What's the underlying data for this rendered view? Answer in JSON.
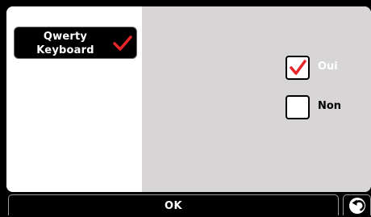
{
  "sidebar": {
    "items": [
      {
        "label": "Qwerty\nKeyboard",
        "icon": "checkmark-icon",
        "selected": true
      }
    ]
  },
  "options": [
    {
      "label": "Oui",
      "checked": true,
      "icon": "checkmark-icon"
    },
    {
      "label": "Non",
      "checked": false
    }
  ],
  "footer": {
    "ok_label": "OK",
    "back_icon": "back-arrow-icon"
  },
  "colors": {
    "check": "#e8262a",
    "content_bg": "#d7d5d6",
    "bar_bg": "#000000"
  }
}
